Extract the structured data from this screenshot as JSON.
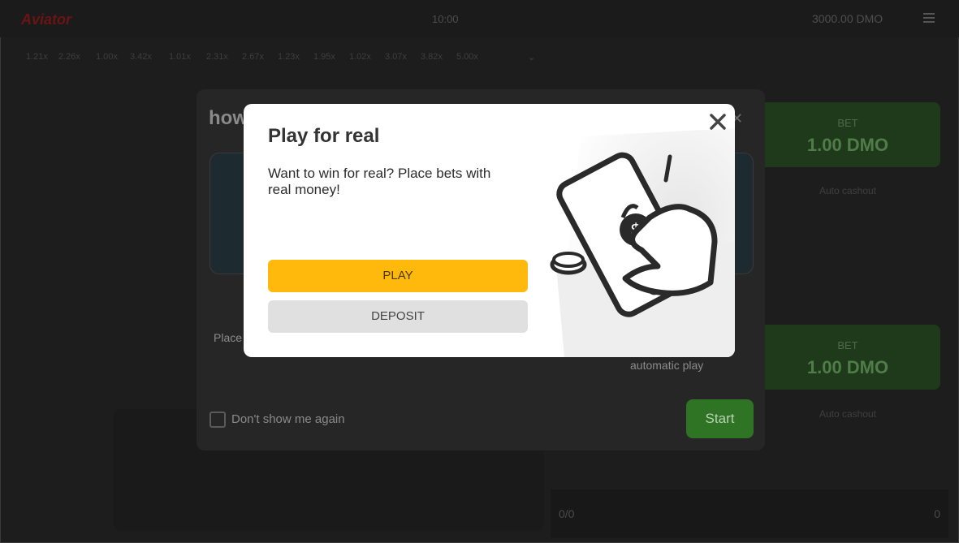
{
  "app": {
    "logo": "Aviator",
    "clock": "10:00",
    "balance": "3000.00 DMO"
  },
  "multipliers": [
    "1.21x",
    "2.26x",
    "1.00x",
    "3.42x",
    "1.01x",
    "2.31x",
    "2.67x",
    "1.23x",
    "1.95x",
    "1.02x",
    "3.07x",
    "3.82x",
    "5.00x"
  ],
  "bet_panels": [
    {
      "label": "BET",
      "amount": "1.00 DMO",
      "autocash": "Auto cashout"
    },
    {
      "label": "BET",
      "amount": "1.00 DMO",
      "autocash": "Auto cashout"
    }
  ],
  "bottom_bar": {
    "left": "0/0",
    "right": "0"
  },
  "howto": {
    "title": "how",
    "place_text": "Place",
    "auto_text": "automatic play",
    "dont_show": "Don't show me again",
    "start": "Start"
  },
  "modal": {
    "title": "Play for real",
    "text": "Want to win for real? Place bets with real money!",
    "play": "PLAY",
    "deposit": "DEPOSIT"
  },
  "colors": {
    "play_button": "#ffb80c",
    "deposit_button": "#e0e0e0",
    "start_button": "#2e7424"
  }
}
